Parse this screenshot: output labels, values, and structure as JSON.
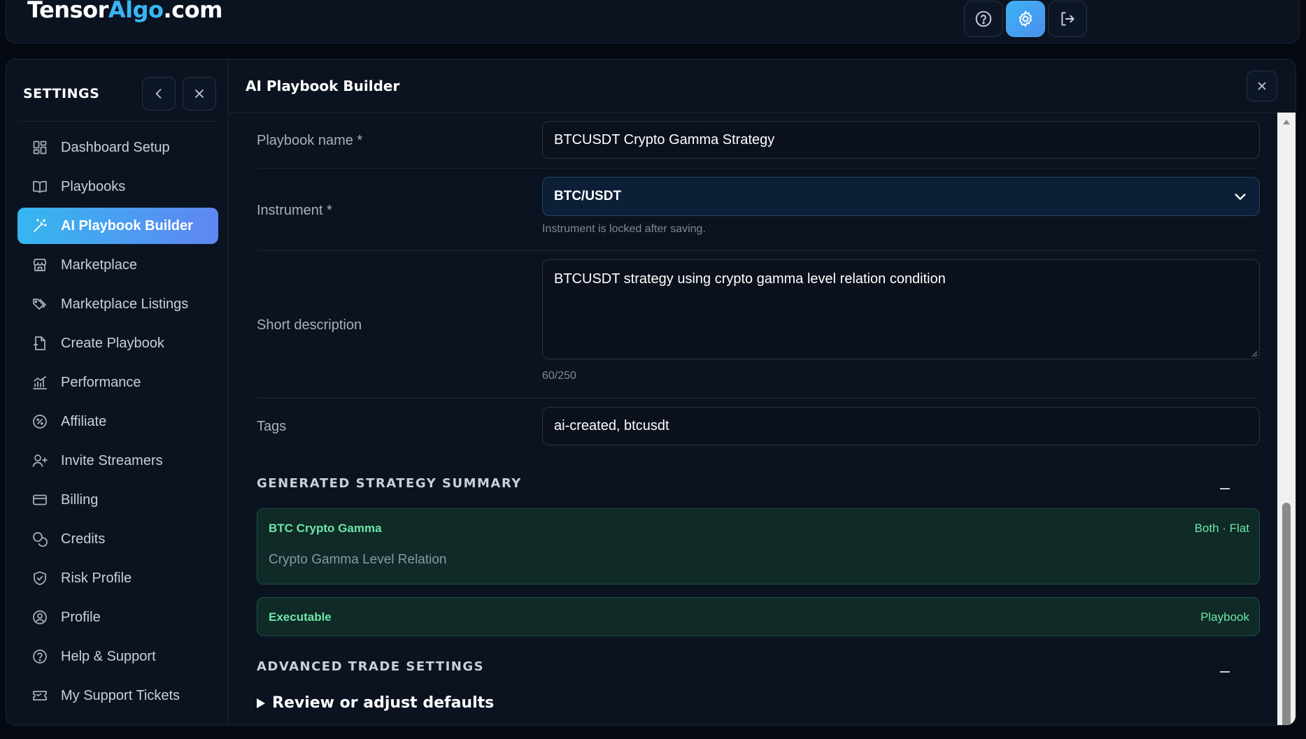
{
  "header": {
    "logo_part1": "Tensor",
    "logo_part2": "Algo",
    "logo_part3": ".com",
    "buttons": [
      {
        "name": "help-icon"
      },
      {
        "name": "gear-icon",
        "active": true
      },
      {
        "name": "logout-icon"
      }
    ]
  },
  "sidebar": {
    "title": "SETTINGS",
    "items": [
      {
        "label": "Dashboard Setup",
        "icon": "dashboard-icon"
      },
      {
        "label": "Playbooks",
        "icon": "book-icon"
      },
      {
        "label": "AI Playbook Builder",
        "icon": "magic-wand-icon",
        "active": true
      },
      {
        "label": "Marketplace",
        "icon": "store-icon"
      },
      {
        "label": "Marketplace Listings",
        "icon": "tags-icon"
      },
      {
        "label": "Create Playbook",
        "icon": "file-plus-icon"
      },
      {
        "label": "Performance",
        "icon": "chart-icon"
      },
      {
        "label": "Affiliate",
        "icon": "percent-badge-icon"
      },
      {
        "label": "Invite Streamers",
        "icon": "user-plus-icon"
      },
      {
        "label": "Billing",
        "icon": "credit-card-icon"
      },
      {
        "label": "Credits",
        "icon": "coins-icon"
      },
      {
        "label": "Risk Profile",
        "icon": "shield-check-icon"
      },
      {
        "label": "Profile",
        "icon": "user-circle-icon"
      },
      {
        "label": "Help & Support",
        "icon": "help-icon"
      },
      {
        "label": "My Support Tickets",
        "icon": "ticket-icon"
      }
    ]
  },
  "main": {
    "title": "AI Playbook Builder",
    "form": {
      "playbook_name_label": "Playbook name *",
      "playbook_name_value": "BTCUSDT Crypto Gamma Strategy",
      "instrument_label": "Instrument *",
      "instrument_value": "BTC/USDT",
      "instrument_hint": "Instrument is locked after saving.",
      "description_label": "Short description",
      "description_value": "BTCUSDT strategy using crypto gamma level relation condition",
      "description_count": "60/250",
      "tags_label": "Tags",
      "tags_value": "ai-created, btcusdt"
    },
    "summary": {
      "title": "GENERATED STRATEGY SUMMARY",
      "card1_title": "BTC Crypto Gamma",
      "card1_right": "Both · Flat",
      "card1_sub": "Crypto Gamma Level Relation",
      "card2_title": "Executable",
      "card2_right": "Playbook"
    },
    "advanced": {
      "title": "ADVANCED TRADE SETTINGS",
      "details_label": "Review or adjust defaults"
    }
  },
  "colors": {
    "accent_start": "#35b7f0",
    "accent_end": "#5f86f2",
    "success_text": "#6ee7a8",
    "background": "#0b1320"
  }
}
